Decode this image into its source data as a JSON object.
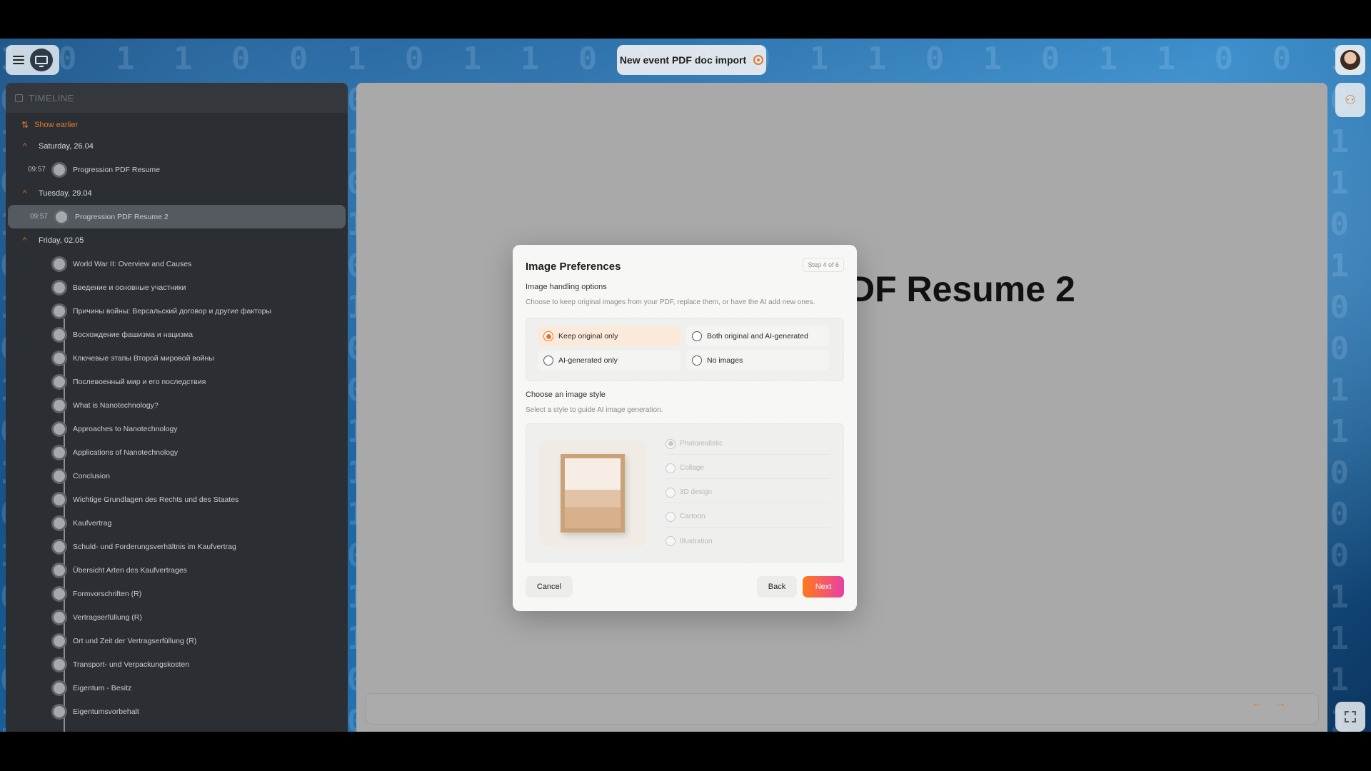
{
  "header": {
    "title": "New event PDF doc import"
  },
  "sidebar": {
    "heading": "TIMELINE",
    "show_earlier": "Show earlier",
    "days": [
      {
        "label": "Saturday, 26.04",
        "events": [
          {
            "time": "09:57",
            "title": "Progression PDF Resume"
          }
        ]
      },
      {
        "label": "Tuesday, 29.04",
        "events": [
          {
            "time": "09:57",
            "title": "Progression PDF Resume 2"
          }
        ]
      },
      {
        "label": "Friday, 02.05",
        "events": [
          {
            "time": "",
            "title": "World War II: Overview and Causes"
          },
          {
            "time": "",
            "title": "Введение и основные участники"
          },
          {
            "time": "",
            "title": "Причины войны: Версальский договор и другие факторы"
          },
          {
            "time": "",
            "title": "Восхождение фашизма и нацизма"
          },
          {
            "time": "",
            "title": "Ключевые этапы Второй мировой войны"
          },
          {
            "time": "",
            "title": "Послевоенный мир и его последствия"
          },
          {
            "time": "",
            "title": "What is Nanotechnology?"
          },
          {
            "time": "",
            "title": "Approaches to Nanotechnology"
          },
          {
            "time": "",
            "title": "Applications of Nanotechnology"
          },
          {
            "time": "",
            "title": "Conclusion"
          },
          {
            "time": "",
            "title": "Wichtige Grundlagen des Rechts und des Staates"
          },
          {
            "time": "",
            "title": "Kaufvertrag"
          },
          {
            "time": "",
            "title": "Schuld- und Forderungsverhältnis im Kaufvertrag"
          },
          {
            "time": "",
            "title": "Übersicht Arten des Kaufvertrages"
          },
          {
            "time": "",
            "title": "Formvorschriften (R)"
          },
          {
            "time": "",
            "title": "Vertragserfüllung (R)"
          },
          {
            "time": "",
            "title": "Ort und Zeit der Vertragserfüllung (R)"
          },
          {
            "time": "",
            "title": "Transport- und Verpackungskosten"
          },
          {
            "time": "",
            "title": "Eigentum - Besitz"
          },
          {
            "time": "",
            "title": "Eigentumsvorbehalt"
          }
        ]
      }
    ]
  },
  "main": {
    "slide_title": "DF Resume 2"
  },
  "dialog": {
    "title": "Image Preferences",
    "step": "Step 4 of 6",
    "handling_title": "Image handling options",
    "handling_sub": "Choose to keep original images from your PDF, replace them, or have the AI add new ones.",
    "handling_options": [
      {
        "label": "Keep original only",
        "selected": true
      },
      {
        "label": "Both original and AI-generated",
        "selected": false
      },
      {
        "label": "AI-generated only",
        "selected": false
      },
      {
        "label": "No images",
        "selected": false
      }
    ],
    "style_title": "Choose an image style",
    "style_sub": "Select a style to guide AI image generation.",
    "styles": [
      {
        "label": "Photorealistic",
        "selected": true
      },
      {
        "label": "Collage",
        "selected": false
      },
      {
        "label": "3D design",
        "selected": false
      },
      {
        "label": "Cartoon",
        "selected": false
      },
      {
        "label": "Illustration",
        "selected": false
      }
    ],
    "cancel": "Cancel",
    "back": "Back",
    "next": "Next"
  },
  "colors": {
    "accent": "#e07b2e",
    "sidebar_bg": "#2b2f33",
    "next_gradient_start": "#ff7a1a",
    "next_gradient_end": "#e83ea8"
  }
}
